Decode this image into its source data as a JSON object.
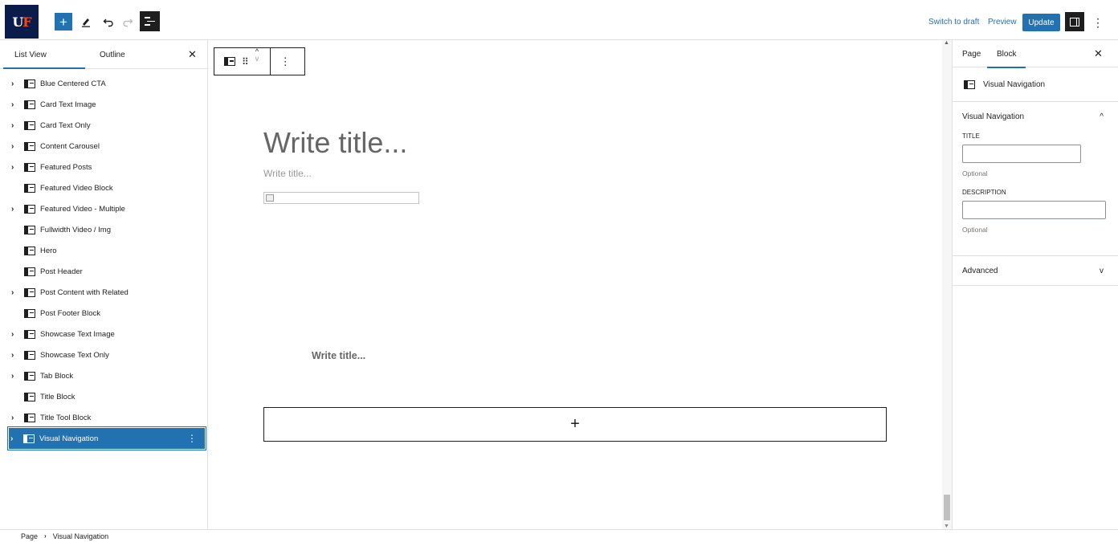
{
  "header": {
    "logo_text": "UF",
    "switch_to_draft": "Switch to draft",
    "preview": "Preview",
    "update": "Update"
  },
  "list_view": {
    "tab_list": "List View",
    "tab_outline": "Outline",
    "items": [
      {
        "label": "Blue Centered CTA",
        "has_children": true
      },
      {
        "label": "Card Text Image",
        "has_children": true
      },
      {
        "label": "Card Text Only",
        "has_children": true
      },
      {
        "label": "Content Carousel",
        "has_children": true
      },
      {
        "label": "Featured Posts",
        "has_children": true
      },
      {
        "label": "Featured Video Block",
        "has_children": false
      },
      {
        "label": "Featured Video - Multiple",
        "has_children": true
      },
      {
        "label": "Fullwidth Video / Img",
        "has_children": false
      },
      {
        "label": "Hero",
        "has_children": false
      },
      {
        "label": "Post Header",
        "has_children": false
      },
      {
        "label": "Post Content with Related",
        "has_children": true
      },
      {
        "label": "Post Footer Block",
        "has_children": false
      },
      {
        "label": "Showcase Text Image",
        "has_children": true
      },
      {
        "label": "Showcase Text Only",
        "has_children": true
      },
      {
        "label": "Tab Block",
        "has_children": true
      },
      {
        "label": "Title Block",
        "has_children": false
      },
      {
        "label": "Title Tool Block",
        "has_children": true
      },
      {
        "label": "Visual Navigation",
        "has_children": true,
        "selected": true
      }
    ]
  },
  "canvas": {
    "big_title_placeholder": "Write title...",
    "small_title_placeholder": "Write title...",
    "mid_title_placeholder": "Write title...",
    "appender_symbol": "+"
  },
  "settings": {
    "tab_page": "Page",
    "tab_block": "Block",
    "block_name": "Visual Navigation",
    "panel_title": "Visual Navigation",
    "title_label": "TITLE",
    "title_value": "",
    "title_help": "Optional",
    "description_label": "DESCRIPTION",
    "description_value": "",
    "description_help": "Optional",
    "advanced_label": "Advanced"
  },
  "breadcrumb": {
    "root": "Page",
    "current": "Visual Navigation"
  },
  "colors": {
    "accent": "#2271b1",
    "logo_bg": "#0a1d4a",
    "logo_accent": "#fa4616"
  }
}
